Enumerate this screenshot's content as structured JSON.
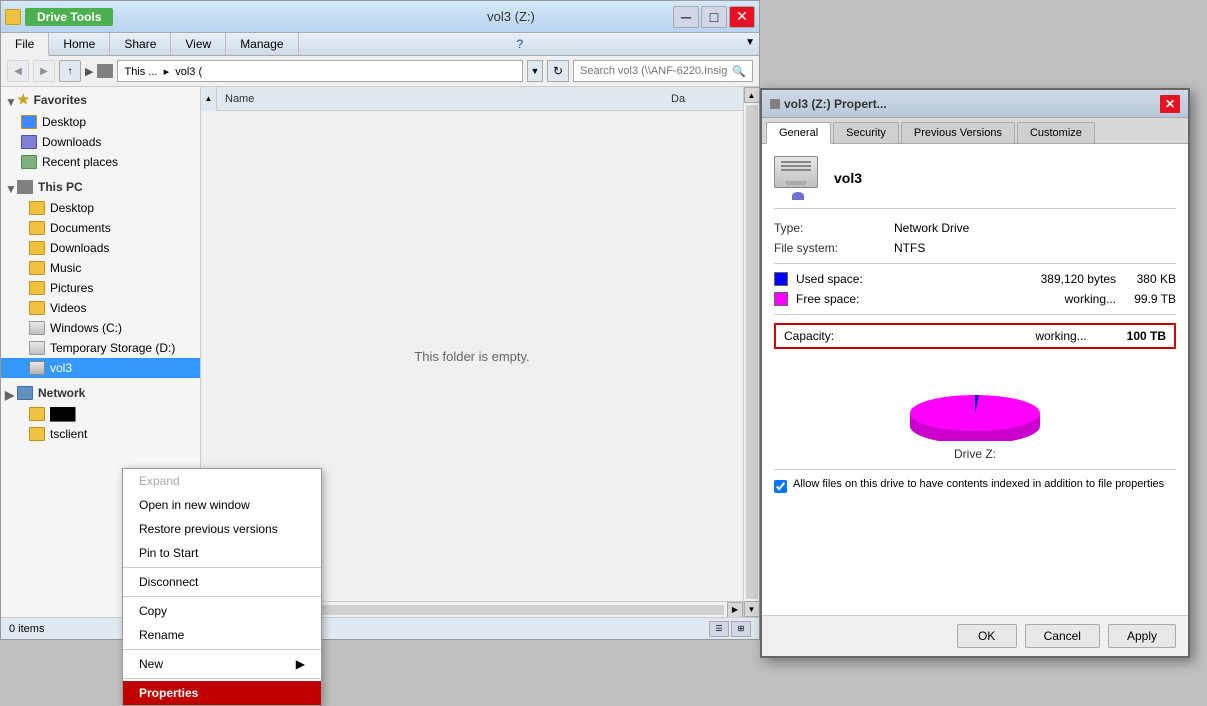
{
  "explorer": {
    "title": "vol3 (Z:)",
    "ribbon_tabs": [
      "File",
      "Home",
      "Share",
      "View",
      "Manage"
    ],
    "active_tab": "File",
    "drive_tools_label": "Drive Tools",
    "address_path": "This ...  ▸  vol3 (",
    "search_placeholder": "Search vol3 (\\\\ANF-6220.Insig...",
    "empty_msg": "This folder is empty.",
    "status_items": "0 items",
    "columns": [
      "Name",
      "Da"
    ],
    "favorites": {
      "label": "Favorites",
      "items": [
        "Desktop",
        "Downloads",
        "Recent places"
      ]
    },
    "this_pc": {
      "label": "This PC",
      "items": [
        "Desktop",
        "Documents",
        "Downloads",
        "Music",
        "Pictures",
        "Videos",
        "Windows (C:)",
        "Temporary Storage (D:)",
        "vol3"
      ]
    },
    "network": {
      "label": "Network",
      "items": [
        "",
        "tsclient"
      ]
    }
  },
  "context_menu": {
    "items": [
      {
        "label": "Expand",
        "disabled": true
      },
      {
        "label": "Open in new window",
        "disabled": false
      },
      {
        "label": "Restore previous versions",
        "disabled": false
      },
      {
        "label": "Pin to Start",
        "disabled": false
      },
      {
        "label": "Disconnect",
        "disabled": false
      },
      {
        "label": "Copy",
        "disabled": false
      },
      {
        "label": "Rename",
        "disabled": false
      },
      {
        "label": "New",
        "disabled": false,
        "has_submenu": true
      },
      {
        "label": "Properties",
        "highlighted": true
      }
    ]
  },
  "properties_dialog": {
    "title": "vol3 (Z:) Propert...",
    "tabs": [
      "General",
      "Security",
      "Previous Versions",
      "Customize"
    ],
    "active_tab": "General",
    "volume_name": "vol3",
    "type_label": "Type:",
    "type_value": "Network Drive",
    "filesystem_label": "File system:",
    "filesystem_value": "NTFS",
    "used_space_label": "Used space:",
    "used_space_bytes": "389,120 bytes",
    "used_space_human": "380 KB",
    "free_space_label": "Free space:",
    "free_space_bytes": "working...",
    "free_space_human": "99.9 TB",
    "capacity_label": "Capacity:",
    "capacity_bytes": "working...",
    "capacity_human": "100 TB",
    "drive_label": "Drive Z:",
    "checkbox_label": "Allow files on this drive to have contents indexed in addition to file properties",
    "buttons": [
      "OK",
      "Cancel",
      "Apply"
    ],
    "used_color": "#0000ff",
    "free_color": "#ff00ff"
  }
}
